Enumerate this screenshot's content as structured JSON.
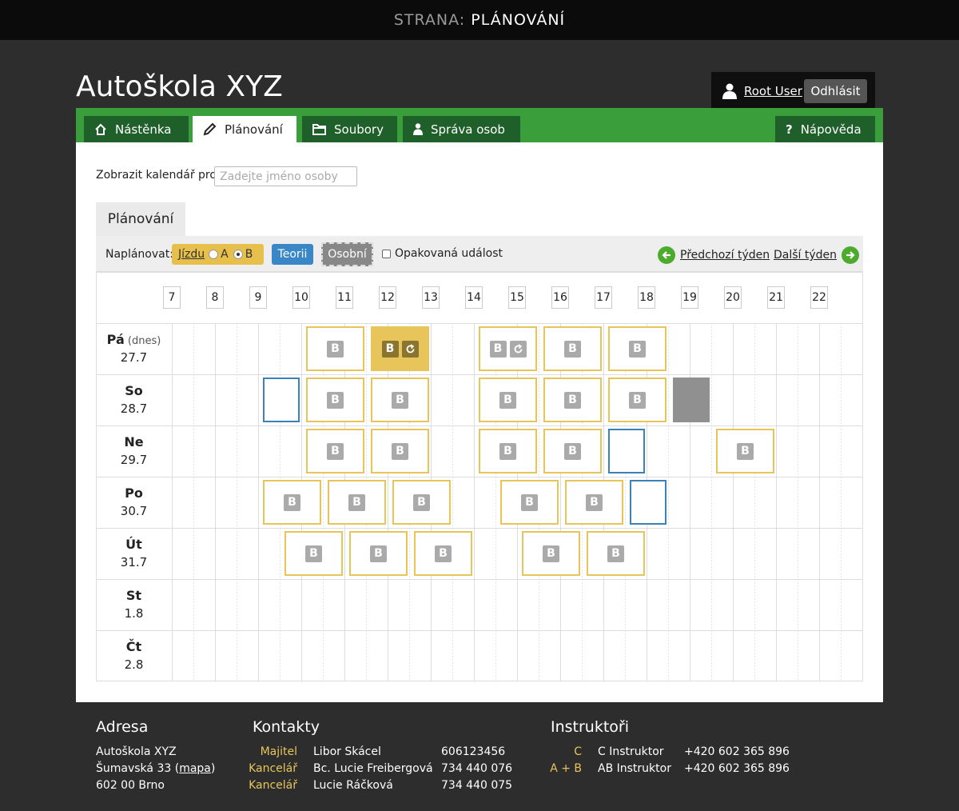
{
  "topbar": {
    "label": "STRANA:",
    "value": "PLÁNOVÁNÍ"
  },
  "site_title": "Autoškola XYZ",
  "user": {
    "name": "Root User",
    "logout": "Odhlásit"
  },
  "nav": {
    "tabs": [
      {
        "label": "Nástěnka",
        "icon": "home-icon"
      },
      {
        "label": "Plánování",
        "icon": "pencil-icon",
        "active": true
      },
      {
        "label": "Soubory",
        "icon": "folder-icon"
      },
      {
        "label": "Správa osob",
        "icon": "person-icon"
      }
    ],
    "help": "Nápověda"
  },
  "search": {
    "label": "Zobrazit kalendář pro:",
    "placeholder": "Zadejte jméno osoby"
  },
  "planner": {
    "tab": "Plánování",
    "schedule_label": "Naplánovat:",
    "btn_jizdu": "Jízdu",
    "opt_a": "A",
    "opt_b": "B",
    "btn_teorii": "Teorii",
    "btn_osobni": "Osobní",
    "repeat_label": "Opakovaná událost",
    "prev": "Předchozí týden",
    "next": "Další týden"
  },
  "calendar": {
    "hours": [
      "7",
      "8",
      "9",
      "10",
      "11",
      "12",
      "13",
      "14",
      "15",
      "16",
      "17",
      "18",
      "19",
      "20",
      "21",
      "22"
    ],
    "days": [
      {
        "name": "Pá",
        "note": "(dnes)",
        "date": "27.7"
      },
      {
        "name": "So",
        "note": "",
        "date": "28.7"
      },
      {
        "name": "Ne",
        "note": "",
        "date": "29.7"
      },
      {
        "name": "Po",
        "note": "",
        "date": "30.7"
      },
      {
        "name": "Út",
        "note": "",
        "date": "31.7"
      },
      {
        "name": "St",
        "note": "",
        "date": "1.8"
      },
      {
        "name": "Čt",
        "note": "",
        "date": "2.8"
      }
    ],
    "badge": "B",
    "events": [
      {
        "day": 0,
        "start": 10,
        "len": 1.5,
        "type": "jizda"
      },
      {
        "day": 0,
        "start": 11.5,
        "len": 1.5,
        "type": "jizda",
        "filled": true,
        "repeat": true
      },
      {
        "day": 0,
        "start": 14,
        "len": 1.5,
        "type": "jizda",
        "repeat": true
      },
      {
        "day": 0,
        "start": 15.5,
        "len": 1.5,
        "type": "jizda"
      },
      {
        "day": 0,
        "start": 17,
        "len": 1.5,
        "type": "jizda"
      },
      {
        "day": 1,
        "start": 9,
        "len": 1,
        "type": "teorie"
      },
      {
        "day": 1,
        "start": 10,
        "len": 1.5,
        "type": "jizda"
      },
      {
        "day": 1,
        "start": 11.5,
        "len": 1.5,
        "type": "jizda"
      },
      {
        "day": 1,
        "start": 14,
        "len": 1.5,
        "type": "jizda"
      },
      {
        "day": 1,
        "start": 15.5,
        "len": 1.5,
        "type": "jizda"
      },
      {
        "day": 1,
        "start": 17,
        "len": 1.5,
        "type": "jizda"
      },
      {
        "day": 1,
        "start": 18.5,
        "len": 1,
        "type": "osobni"
      },
      {
        "day": 2,
        "start": 10,
        "len": 1.5,
        "type": "jizda"
      },
      {
        "day": 2,
        "start": 11.5,
        "len": 1.5,
        "type": "jizda"
      },
      {
        "day": 2,
        "start": 14,
        "len": 1.5,
        "type": "jizda"
      },
      {
        "day": 2,
        "start": 15.5,
        "len": 1.5,
        "type": "jizda"
      },
      {
        "day": 2,
        "start": 17,
        "len": 1,
        "type": "teorie"
      },
      {
        "day": 2,
        "start": 19.5,
        "len": 1.5,
        "type": "jizda"
      },
      {
        "day": 3,
        "start": 9,
        "len": 1.5,
        "type": "jizda"
      },
      {
        "day": 3,
        "start": 10.5,
        "len": 1.5,
        "type": "jizda"
      },
      {
        "day": 3,
        "start": 12,
        "len": 1.5,
        "type": "jizda"
      },
      {
        "day": 3,
        "start": 14.5,
        "len": 1.5,
        "type": "jizda"
      },
      {
        "day": 3,
        "start": 16,
        "len": 1.5,
        "type": "jizda"
      },
      {
        "day": 3,
        "start": 17.5,
        "len": 1,
        "type": "teorie"
      },
      {
        "day": 4,
        "start": 9.5,
        "len": 1.5,
        "type": "jizda"
      },
      {
        "day": 4,
        "start": 11,
        "len": 1.5,
        "type": "jizda"
      },
      {
        "day": 4,
        "start": 12.5,
        "len": 1.5,
        "type": "jizda"
      },
      {
        "day": 4,
        "start": 15,
        "len": 1.5,
        "type": "jizda"
      },
      {
        "day": 4,
        "start": 16.5,
        "len": 1.5,
        "type": "jizda"
      }
    ]
  },
  "footer": {
    "address": {
      "title": "Adresa",
      "line1": "Autoškola XYZ",
      "line2_pre": "Šumavská 33 (",
      "map": "mapa",
      "line2_post": ")",
      "line3": "602 00 Brno"
    },
    "contacts": {
      "title": "Kontakty",
      "rows": [
        {
          "role": "Majitel",
          "name": "Libor Skácel",
          "phone": "606123456"
        },
        {
          "role": "Kancelář",
          "name": "Bc. Lucie Freibergová",
          "phone": "734 440 076"
        },
        {
          "role": "Kancelář",
          "name": "Lucie Ráčková",
          "phone": "734 440 075"
        }
      ]
    },
    "instructors": {
      "title": "Instruktoři",
      "rows": [
        {
          "category": "C",
          "name": "C Instruktor",
          "phone": "+420 602 365 896"
        },
        {
          "category": "A + B",
          "name": "AB Instruktor",
          "phone": "+420 602 365 896"
        }
      ]
    }
  },
  "colors": {
    "nav_green": "#3a9e3a",
    "tab_dark": "#1f5f2a",
    "jizda": "#e8c55a",
    "teorie": "#3b82b8",
    "osobni": "#909090"
  }
}
